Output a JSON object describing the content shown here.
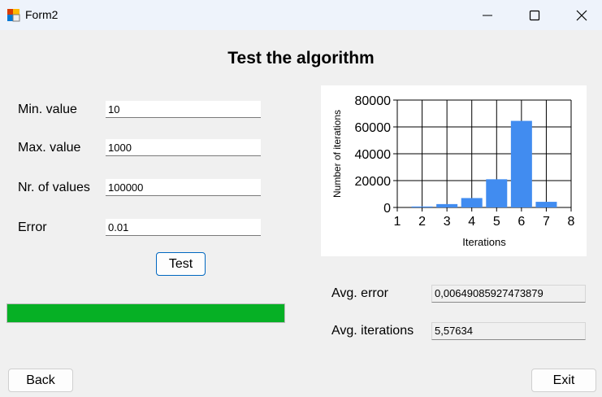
{
  "window": {
    "title": "Form2"
  },
  "heading": "Test the algorithm",
  "form": {
    "min_label": "Min. value",
    "min_value": "10",
    "max_label": "Max. value",
    "max_value": "1000",
    "count_label": "Nr. of values",
    "count_value": "100000",
    "error_label": "Error",
    "error_value": "0.01",
    "test_button": "Test"
  },
  "progress": {
    "fraction": 1.0,
    "color": "#06b025"
  },
  "chart_data": {
    "type": "bar",
    "x": [
      1,
      2,
      3,
      4,
      5,
      6,
      7
    ],
    "values": [
      0,
      700,
      2500,
      7000,
      21000,
      64500,
      4200
    ],
    "xlabel": "Iterations",
    "ylabel": "Number of iterations",
    "xticks": [
      "1",
      "2",
      "3",
      "4",
      "5",
      "6",
      "7",
      "8"
    ],
    "yticks": [
      "0",
      "20000",
      "40000",
      "60000",
      "80000"
    ],
    "xlim": [
      1,
      8
    ],
    "ylim": [
      0,
      80000
    ],
    "grid": true,
    "bar_color": "#418cf0"
  },
  "results": {
    "avg_error_label": "Avg. error",
    "avg_error_value": "0,00649085927473879",
    "avg_iter_label": "Avg. iterations",
    "avg_iter_value": "5,57634"
  },
  "footer": {
    "back_button": "Back",
    "exit_button": "Exit"
  }
}
